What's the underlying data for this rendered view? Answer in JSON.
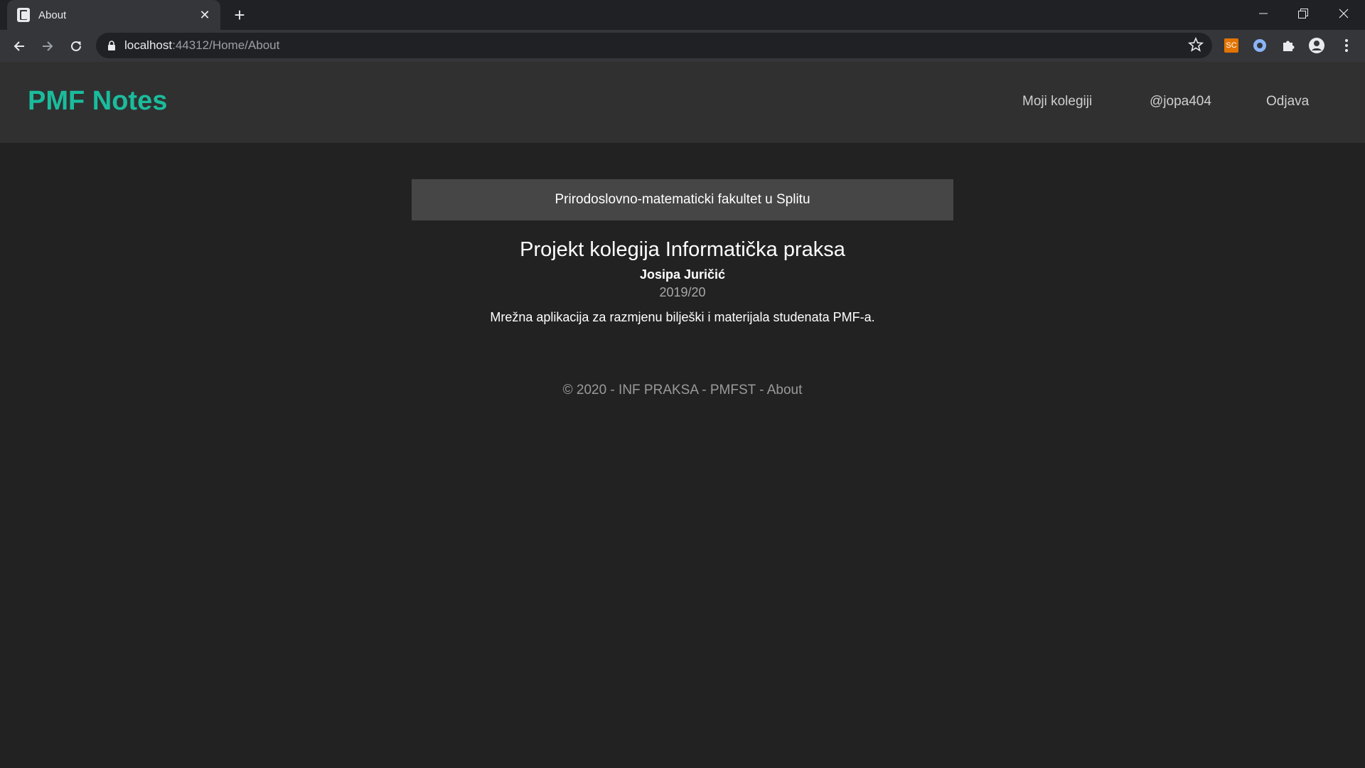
{
  "browser": {
    "tab_title": "About",
    "url_host": "localhost",
    "url_path": ":44312/Home/About",
    "extension_label": "SC"
  },
  "navbar": {
    "brand": "PMF Notes",
    "links": [
      {
        "label": "Moji kolegiji"
      },
      {
        "label": "@jopa404"
      },
      {
        "label": "Odjava"
      }
    ]
  },
  "main": {
    "banner": "Prirodoslovno-matematicki fakultet u Splitu",
    "title": "Projekt kolegija Informatička praksa",
    "author": "Josipa Juričić",
    "year": "2019/20",
    "description": "Mrežna aplikacija za razmjenu bilješki i materijala studenata PMF-a."
  },
  "footer": {
    "text": "© 2020 - INF PRAKSA - PMFST - ",
    "link": "About"
  },
  "colors": {
    "brand": "#1abc9c",
    "navbar_bg": "#303030",
    "page_bg": "#222222",
    "banner_bg": "#464646"
  }
}
